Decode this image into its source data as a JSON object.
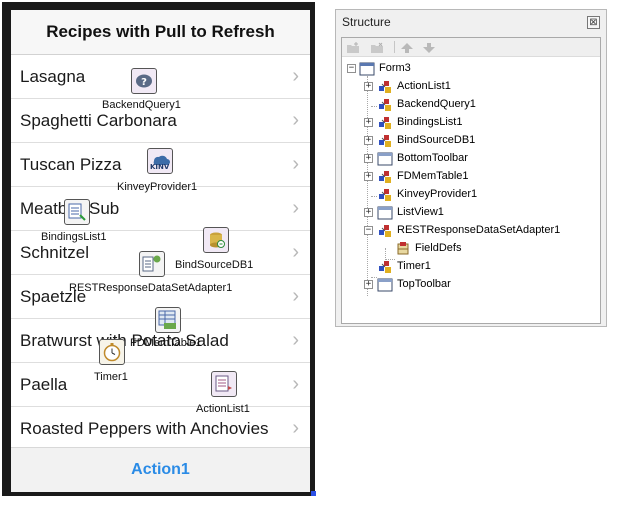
{
  "form": {
    "title": "Recipes with Pull to Refresh",
    "items": [
      {
        "label": "Lasagna"
      },
      {
        "label": "Spaghetti Carbonara"
      },
      {
        "label": "Tuscan Pizza"
      },
      {
        "label": "Meatball Sub"
      },
      {
        "label": "Schnitzel"
      },
      {
        "label": "Spaetzle"
      },
      {
        "label": "Bratwurst with Potato Salad"
      },
      {
        "label": "Paella"
      },
      {
        "label": "Roasted Peppers with Anchovies"
      }
    ],
    "chevron": "›",
    "bottom_action": "Action1",
    "components": {
      "backendquery": "BackendQuery1",
      "kinvey": "KinveyProvider1",
      "kinvey_badge": "KINV",
      "bindings": "BindingsList1",
      "bindsource": "BindSourceDB1",
      "restadapter": "RESTResponseDataSetAdapter1",
      "fdmemtable": "FDMemTable1",
      "timer": "Timer1",
      "actionlist": "ActionList1"
    }
  },
  "structure": {
    "title": "Structure",
    "close_glyph": "⊠",
    "expanded_glyph": "−",
    "collapsed_glyph": "+",
    "root": "Form3",
    "nodes": [
      {
        "label": "ActionList1",
        "icon": "component-icon",
        "expander": "+"
      },
      {
        "label": "BackendQuery1",
        "icon": "component-icon",
        "expander": ""
      },
      {
        "label": "BindingsList1",
        "icon": "component-icon",
        "expander": "+"
      },
      {
        "label": "BindSourceDB1",
        "icon": "component-icon",
        "expander": "+"
      },
      {
        "label": "BottomToolbar",
        "icon": "control-icon",
        "expander": "+"
      },
      {
        "label": "FDMemTable1",
        "icon": "component-icon",
        "expander": "+"
      },
      {
        "label": "KinveyProvider1",
        "icon": "component-icon",
        "expander": ""
      },
      {
        "label": "ListView1",
        "icon": "control-icon",
        "expander": "+"
      },
      {
        "label": "RESTResponseDataSetAdapter1",
        "icon": "component-icon",
        "expander": "−"
      },
      {
        "label": "FieldDefs",
        "icon": "fielddefs-icon",
        "expander": "",
        "child": true
      },
      {
        "label": "Timer1",
        "icon": "component-icon",
        "expander": ""
      },
      {
        "label": "TopToolbar",
        "icon": "control-icon",
        "expander": "+"
      }
    ]
  },
  "colors": {
    "action": "#2a8be6",
    "selection": "#2b50e6"
  }
}
